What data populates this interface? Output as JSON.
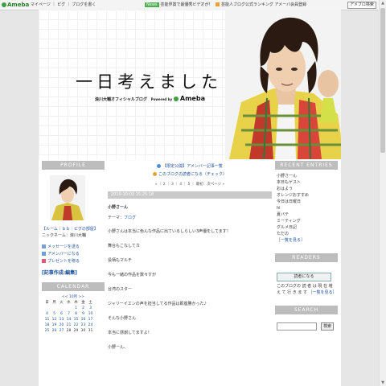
{
  "topbar": {
    "logo": "Ameba",
    "nav": "マイページ ｜ ピグ ｜ ブログを書く",
    "news_badge": "News",
    "news": "芸能界賞で最優秀ビデオが！",
    "news2": "芸能人ブログ公式ランキング アメーバ会員登録",
    "search_button": "アメブロ検索"
  },
  "header": {
    "title": "一日考えました",
    "subtitle": "浪川大輔オフィシャルブログ",
    "powered_by": "Powered by",
    "brand": "Ameba"
  },
  "left": {
    "profile_title": "PROFILE",
    "profile_caption": "【ルーム｜ｂｂ｜ピグの部屋】",
    "profile_nickname": "ニックネーム：浪川大輔",
    "links": [
      "メッセージを送る",
      "アメンバーになる",
      "プレゼントを贈る"
    ],
    "special": "[記事作成:編集]",
    "calendar_title": "CALENDAR",
    "calendar_month": "<< 10月 >>",
    "calendar_days": [
      "日",
      "月",
      "火",
      "水",
      "木",
      "金",
      "土"
    ],
    "calendar_rows": [
      [
        "",
        "",
        "",
        "",
        "1",
        "2",
        "3"
      ],
      [
        "4",
        "5",
        "6",
        "7",
        "8",
        "9",
        "10"
      ],
      [
        "11",
        "12",
        "13",
        "14",
        "15",
        "16",
        "17"
      ],
      [
        "18",
        "19",
        "20",
        "21",
        "22",
        "23",
        "24"
      ],
      [
        "25",
        "26",
        "27",
        "28",
        "29",
        "30",
        "31"
      ]
    ]
  },
  "main": {
    "link1": "【限定公開】アメンバー記事一覧",
    "link2": "このブログの読者になる（チェック）",
    "pager": "« ｜ 2 ｜ 3 ｜ 4 ｜ 5 ｜ 最初　次ページ »",
    "date": "2010-10-03 15:25:18",
    "entry_title": "小野さーん",
    "theme_label": "テーマ：",
    "theme": "ブログ",
    "paragraphs": [
      "小野さんは本当に色んな作品に出ているしらしい3声優をしてます！",
      "舞台もこなしてカ",
      "役柄もマルチ",
      "今も一緒の作品を数々すが",
      "台湾のスター",
      "ジャリーイエンの声を担当してる作品は即座勝かった♪",
      "そんな小野さん",
      "本当に感謝してますよ！",
      "小野ーん、"
    ]
  },
  "right": {
    "recent_title": "RECENT ENTRIES",
    "recent": [
      "小野さーん",
      "本日もゲスト",
      "おはよう",
      "オレンジおすすめ",
      "今日は日曜日",
      "hi",
      "夏バテ",
      "ミーティング",
      "グルメ日記",
      "ただの"
    ],
    "recent_more": "［一覧を見る］",
    "readers_title": "READERS",
    "reader_button": "読者になる",
    "reader_text": "このブログの 読 者 は 現 在 増 え て 行 き ま す",
    "reader_more": "［一覧を見る］",
    "search_title": "SEARCH",
    "search_button": "検索"
  }
}
